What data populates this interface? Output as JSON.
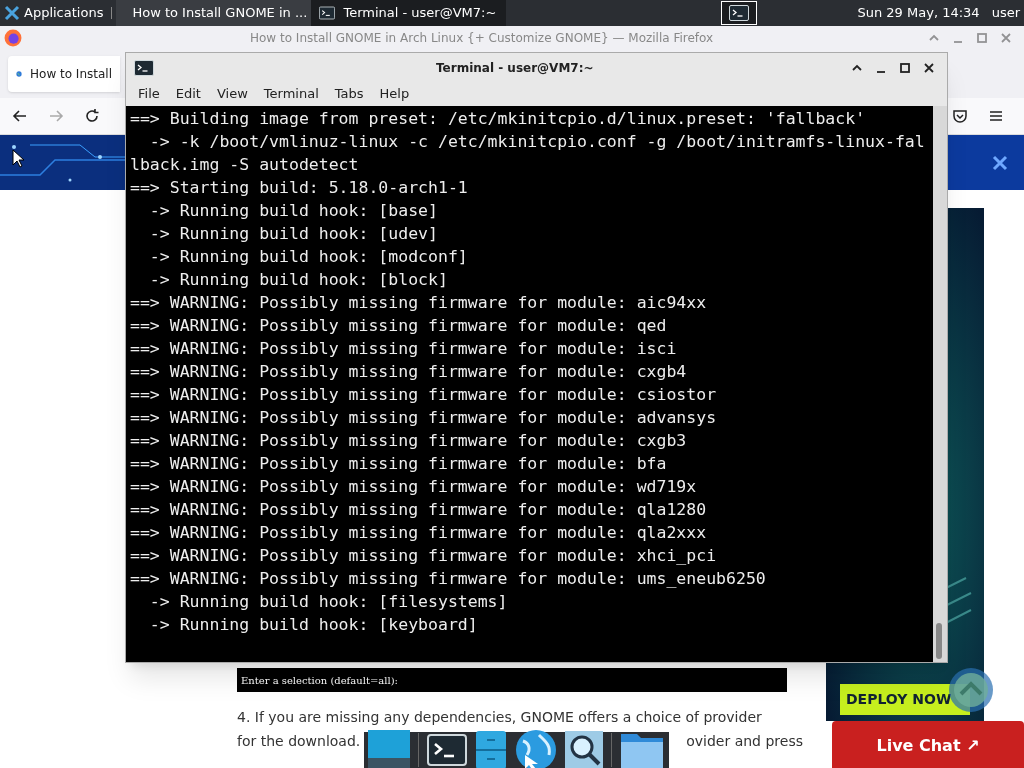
{
  "panel": {
    "apps_menu": "Applications",
    "tasks": [
      {
        "title": "How to Install GNOME in ...",
        "kind": "browser",
        "selected": false
      },
      {
        "title": "Terminal - user@VM7:~",
        "kind": "terminal",
        "selected": true
      }
    ],
    "clock": "Sun 29 May, 14:34",
    "user": "user"
  },
  "firefox": {
    "title": "How to Install GNOME in Arch Linux {+ Customize GNOME} — Mozilla Firefox",
    "tab": "How to Install",
    "code_line": "Enter a selection (default=all):",
    "paragraph_first": "4. If you are missing any dependencies, GNOME offers a choice of provider",
    "paragraph_left": "for the download.",
    "paragraph_right": "ovider and press",
    "deploy_button": "DEPLOY NOW",
    "live_chat": "Live Chat ↗"
  },
  "terminal": {
    "title": "Terminal - user@VM7:~",
    "menu": [
      "File",
      "Edit",
      "View",
      "Terminal",
      "Tabs",
      "Help"
    ],
    "lines": [
      "==> Building image from preset: /etc/mkinitcpio.d/linux.preset: 'fallback'",
      "  -> -k /boot/vmlinuz-linux -c /etc/mkinitcpio.conf -g /boot/initramfs-linux-fal",
      "lback.img -S autodetect",
      "==> Starting build: 5.18.0-arch1-1",
      "  -> Running build hook: [base]",
      "  -> Running build hook: [udev]",
      "  -> Running build hook: [modconf]",
      "  -> Running build hook: [block]",
      "==> WARNING: Possibly missing firmware for module: aic94xx",
      "==> WARNING: Possibly missing firmware for module: qed",
      "==> WARNING: Possibly missing firmware for module: isci",
      "==> WARNING: Possibly missing firmware for module: cxgb4",
      "==> WARNING: Possibly missing firmware for module: csiostor",
      "==> WARNING: Possibly missing firmware for module: advansys",
      "==> WARNING: Possibly missing firmware for module: cxgb3",
      "==> WARNING: Possibly missing firmware for module: bfa",
      "==> WARNING: Possibly missing firmware for module: wd719x",
      "==> WARNING: Possibly missing firmware for module: qla1280",
      "==> WARNING: Possibly missing firmware for module: qla2xxx",
      "==> WARNING: Possibly missing firmware for module: xhci_pci",
      "==> WARNING: Possibly missing firmware for module: ums_eneub6250",
      "  -> Running build hook: [filesystems]",
      "  -> Running build hook: [keyboard]"
    ]
  }
}
